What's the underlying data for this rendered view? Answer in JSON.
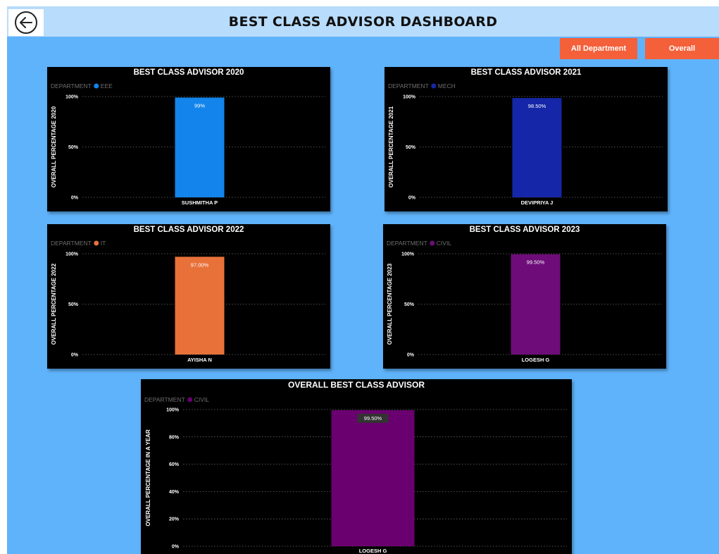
{
  "header": {
    "title": "BEST CLASS ADVISOR DASHBOARD",
    "back_icon": "back-arrow-icon"
  },
  "buttons": {
    "all_department": "All Department",
    "overall": "Overall"
  },
  "colors": {
    "background": "#5fb3fb",
    "header": "#b8dcfb",
    "button": "#f4603a",
    "panel": "#000000"
  },
  "chart_data": [
    {
      "id": "c2020",
      "type": "bar",
      "title": "BEST CLASS ADVISOR 2020",
      "legend_title": "DEPARTMENT",
      "legend_item": "EEE",
      "ylabel": "OVERALL PERCENTAGE 2020",
      "categories": [
        "SUSHMITHA P"
      ],
      "values": [
        99
      ],
      "data_labels": [
        "99%"
      ],
      "yticks": [
        "0%",
        "50%",
        "100%"
      ],
      "ytick_values": [
        0,
        50,
        100
      ],
      "ylim": [
        0,
        100
      ],
      "color": "#1284ec",
      "grid": true
    },
    {
      "id": "c2021",
      "type": "bar",
      "title": "BEST CLASS ADVISOR 2021",
      "legend_title": "DEPARTMENT",
      "legend_item": "MECH",
      "ylabel": "OVERALL PERCENTAGE 2021",
      "categories": [
        "DEVIPRIYA J"
      ],
      "values": [
        98.5
      ],
      "data_labels": [
        "98.50%"
      ],
      "yticks": [
        "0%",
        "50%",
        "100%"
      ],
      "ytick_values": [
        0,
        50,
        100
      ],
      "ylim": [
        0,
        100
      ],
      "color": "#1527a8",
      "grid": true
    },
    {
      "id": "c2022",
      "type": "bar",
      "title": "BEST CLASS ADVISOR 2022",
      "legend_title": "DEPARTMENT",
      "legend_item": "IT",
      "ylabel": "OVERALL PERCENTAGE 2022",
      "categories": [
        "AYISHA N"
      ],
      "values": [
        97
      ],
      "data_labels": [
        "97.00%"
      ],
      "yticks": [
        "0%",
        "50%",
        "100%"
      ],
      "ytick_values": [
        0,
        50,
        100
      ],
      "ylim": [
        0,
        100
      ],
      "color": "#e8713a",
      "grid": true
    },
    {
      "id": "c2023",
      "type": "bar",
      "title": "BEST CLASS ADVISOR 2023",
      "legend_title": "DEPARTMENT",
      "legend_item": "CIVIL",
      "ylabel": "OVERALL PERCENTAGE 2023",
      "categories": [
        "LOGESH G"
      ],
      "values": [
        99.5
      ],
      "data_labels": [
        "99.50%"
      ],
      "yticks": [
        "0%",
        "50%",
        "100%"
      ],
      "ytick_values": [
        0,
        50,
        100
      ],
      "ylim": [
        0,
        100
      ],
      "color": "#6e0d7a",
      "grid": true
    },
    {
      "id": "coverall",
      "type": "bar",
      "title": "OVERALL BEST CLASS ADVISOR",
      "legend_title": "DEPARTMENT",
      "legend_item": "CIVIL",
      "ylabel": "OVERALL PERCENTAGE IN A YEAR",
      "categories": [
        "LOGESH G"
      ],
      "values": [
        99.5
      ],
      "data_labels": [
        "99.50%"
      ],
      "yticks": [
        "0%",
        "20%",
        "40%",
        "60%",
        "80%",
        "100%"
      ],
      "ytick_values": [
        0,
        20,
        40,
        60,
        80,
        100
      ],
      "ylim": [
        0,
        100
      ],
      "color": "#6a0070",
      "grid": true
    }
  ]
}
